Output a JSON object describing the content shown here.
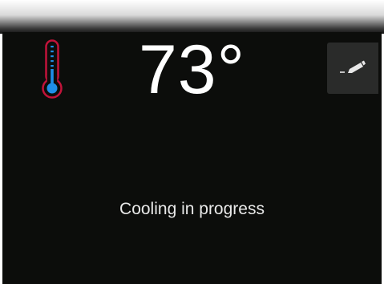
{
  "thermostat": {
    "temperature": "73°",
    "status": "Cooling in progress",
    "icons": {
      "thermometer": "thermometer-icon",
      "edit": "pencil-icon"
    },
    "colors": {
      "thermometer_outline": "#c2133a",
      "thermometer_fill": "#1f8fe8",
      "background": "#0c0d0b",
      "edit_button_bg": "#2a2b2a"
    }
  }
}
